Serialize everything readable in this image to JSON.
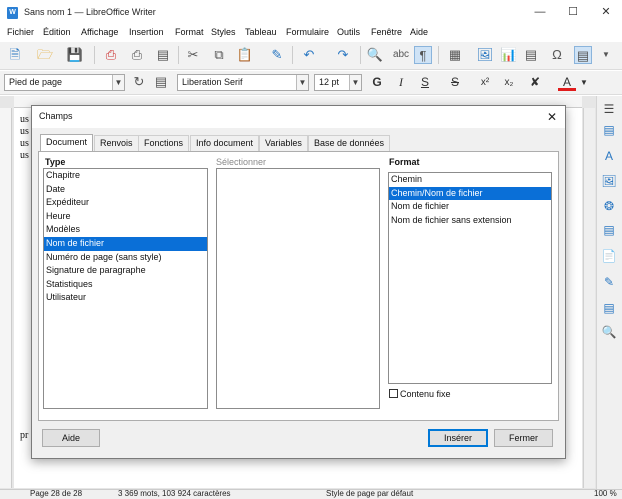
{
  "window": {
    "app_icon": "writer-icon",
    "title": "Sans nom 1 — LibreOffice Writer",
    "controls": [
      "minimize",
      "maximize",
      "close"
    ]
  },
  "menubar": [
    "Fichier",
    "Édition",
    "Affichage",
    "Insertion",
    "Format",
    "Styles",
    "Tableau",
    "Formulaire",
    "Outils",
    "Fenêtre",
    "Aide"
  ],
  "toolbar2": {
    "paragraph_style": "Pied de page",
    "font_name": "Liberation Serif",
    "font_size": "12 pt",
    "buttons": [
      "G",
      "I",
      "S",
      "S",
      "x²",
      "x₂",
      "A"
    ]
  },
  "document": {
    "visible_lines": [
      "us",
      "us",
      "us",
      "us",
      "pr"
    ]
  },
  "dialog": {
    "title": "Champs",
    "tabs": [
      "Document",
      "Renvois",
      "Fonctions",
      "Info document",
      "Variables",
      "Base de données"
    ],
    "active_tab": "Document",
    "type_label": "Type",
    "types": [
      "Chapitre",
      "Date",
      "Expéditeur",
      "Heure",
      "Modèles",
      "Nom de fichier",
      "Numéro de page (sans style)",
      "Signature de paragraphe",
      "Statistiques",
      "Utilisateur"
    ],
    "selected_type": "Nom de fichier",
    "select_label": "Sélectionner",
    "format_label": "Format",
    "formats": [
      "Chemin",
      "Chemin/Nom de fichier",
      "Nom de fichier",
      "Nom de fichier sans extension"
    ],
    "selected_format": "Chemin/Nom de fichier",
    "checkbox_label": "Contenu fixe",
    "checkbox_checked": false,
    "help_button": "Aide",
    "insert_button": "Insérer",
    "close_button": "Fermer"
  },
  "statusbar": {
    "page": "Page 28 de 28",
    "word_count": "3 369 mots, 103 924 caractères",
    "page_style": "Style de page par défaut",
    "zoom": "100 %"
  },
  "colors": {
    "selection": "#0a6fd7",
    "accent": "#2b78c2"
  }
}
